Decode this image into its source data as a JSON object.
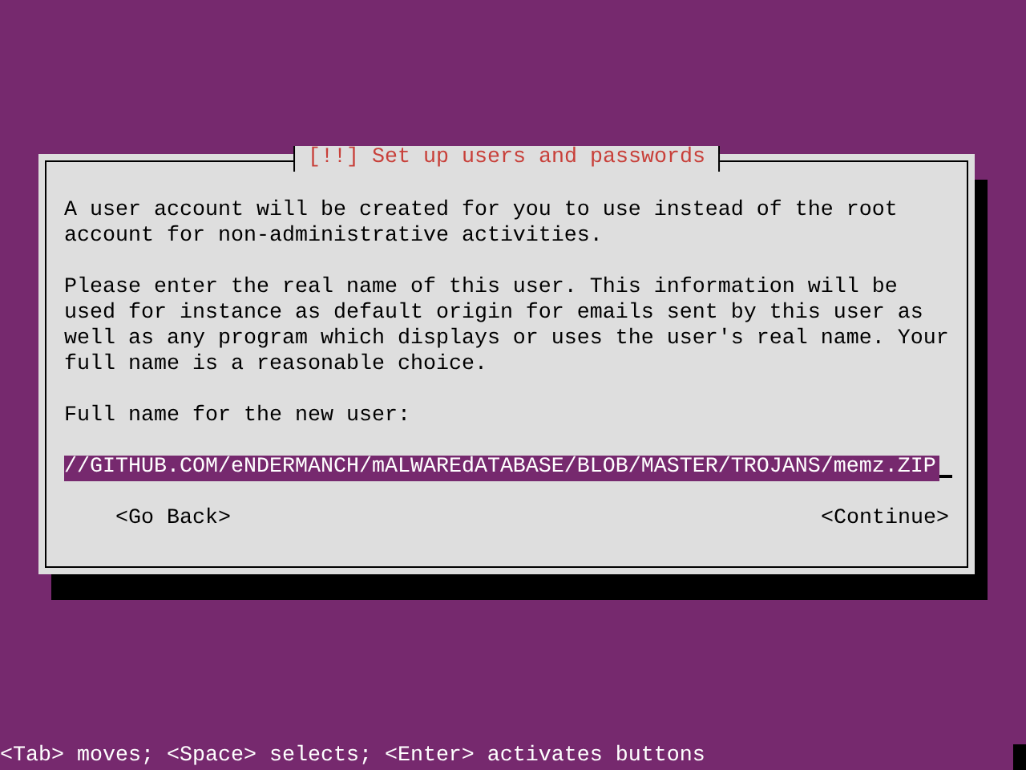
{
  "dialog": {
    "title": "[!!] Set up users and passwords",
    "paragraphs": [
      "A user account will be created for you to use instead of the root account for non-administrative activities.",
      "Please enter the real name of this user. This information will be used for instance as default origin for emails sent by this user as well as any program which displays or uses the user's real name. Your full name is a reasonable choice."
    ],
    "field_label": "Full name for the new user:",
    "field_value": "//GITHUB.COM/eNDERMANCH/mALWAREdATABASE/BLOB/MASTER/TROJANS/memz.ZIP",
    "buttons": [
      {
        "label": "<Go Back>",
        "selected": false
      },
      {
        "label": "<Continue>",
        "selected": false
      }
    ]
  },
  "status_bar": "<Tab> moves; <Space> selects; <Enter> activates buttons"
}
